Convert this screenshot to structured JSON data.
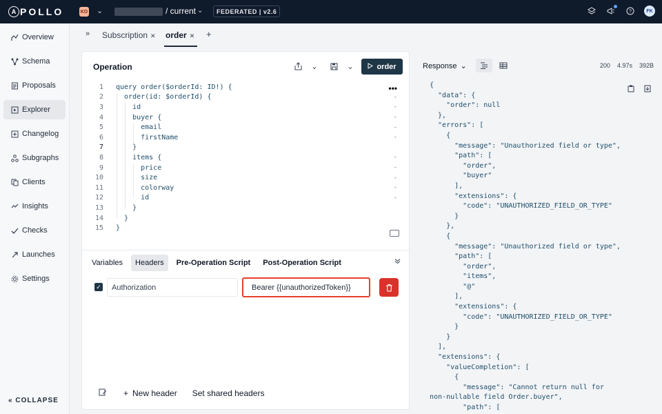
{
  "topbar": {
    "logo": "APOLLO",
    "org_badge": "KO",
    "graph_variant": "/ current",
    "federation_badge": "FEDERATED | v2.6",
    "avatar": "FK",
    "icons": [
      "layers-icon",
      "megaphone-icon",
      "help-icon"
    ]
  },
  "sidebar": {
    "items": [
      {
        "label": "Overview",
        "icon": "overview-icon"
      },
      {
        "label": "Schema",
        "icon": "schema-icon"
      },
      {
        "label": "Proposals",
        "icon": "proposals-icon"
      },
      {
        "label": "Explorer",
        "icon": "explorer-icon",
        "active": true
      },
      {
        "label": "Changelog",
        "icon": "changelog-icon"
      },
      {
        "label": "Subgraphs",
        "icon": "subgraphs-icon"
      },
      {
        "label": "Clients",
        "icon": "clients-icon"
      },
      {
        "label": "Insights",
        "icon": "insights-icon"
      },
      {
        "label": "Checks",
        "icon": "checks-icon"
      },
      {
        "label": "Launches",
        "icon": "launches-icon"
      },
      {
        "label": "Settings",
        "icon": "settings-icon"
      }
    ],
    "collapse_label": "COLLAPSE"
  },
  "tabs": {
    "items": [
      {
        "label": "Subscription",
        "active": false
      },
      {
        "label": "order",
        "active": true
      }
    ],
    "add_label": "+"
  },
  "operation": {
    "title": "Operation",
    "run_label": "order",
    "code_lines": [
      "query order($orderId: ID!) {",
      "  order(id: $orderId) {",
      "    id",
      "    buyer {",
      "      email",
      "      firstName",
      "    }",
      "    items {",
      "      price",
      "      size",
      "      colorway",
      "      id",
      "    }",
      "  }",
      "}"
    ],
    "line_numbers": [
      "1",
      "2",
      "3",
      "4",
      "5",
      "6",
      "7",
      "8",
      "9",
      "10",
      "11",
      "12",
      "13",
      "14",
      "15"
    ],
    "subtabs": [
      "Variables",
      "Headers",
      "Pre-Operation Script",
      "Post-Operation Script"
    ],
    "active_subtab": "Headers",
    "header_row": {
      "enabled": true,
      "key": "Authorization",
      "value": "Bearer {{unauthorizedToken}}"
    },
    "footer": {
      "new_header": "New header",
      "shared_headers": "Set shared headers"
    }
  },
  "response": {
    "label": "Response",
    "status": "200",
    "time": "4.97s",
    "size": "392B",
    "json_lines": [
      "{",
      "  \"data\": {",
      "    \"order\": null",
      "  },",
      "  \"errors\": [",
      "    {",
      "      \"message\": \"Unauthorized field or type\",",
      "      \"path\": [",
      "        \"order\",",
      "        \"buyer\"",
      "      ],",
      "      \"extensions\": {",
      "        \"code\": \"UNAUTHORIZED_FIELD_OR_TYPE\"",
      "      }",
      "    },",
      "    {",
      "      \"message\": \"Unauthorized field or type\",",
      "      \"path\": [",
      "        \"order\",",
      "        \"items\",",
      "        \"@\"",
      "      ],",
      "      \"extensions\": {",
      "        \"code\": \"UNAUTHORIZED_FIELD_OR_TYPE\"",
      "      }",
      "    }",
      "  ],",
      "  \"extensions\": {",
      "    \"valueCompletion\": [",
      "      {",
      "        \"message\": \"Cannot return null for",
      "non-nullable field Order.buyer\",",
      "        \"path\": ["
    ]
  }
}
